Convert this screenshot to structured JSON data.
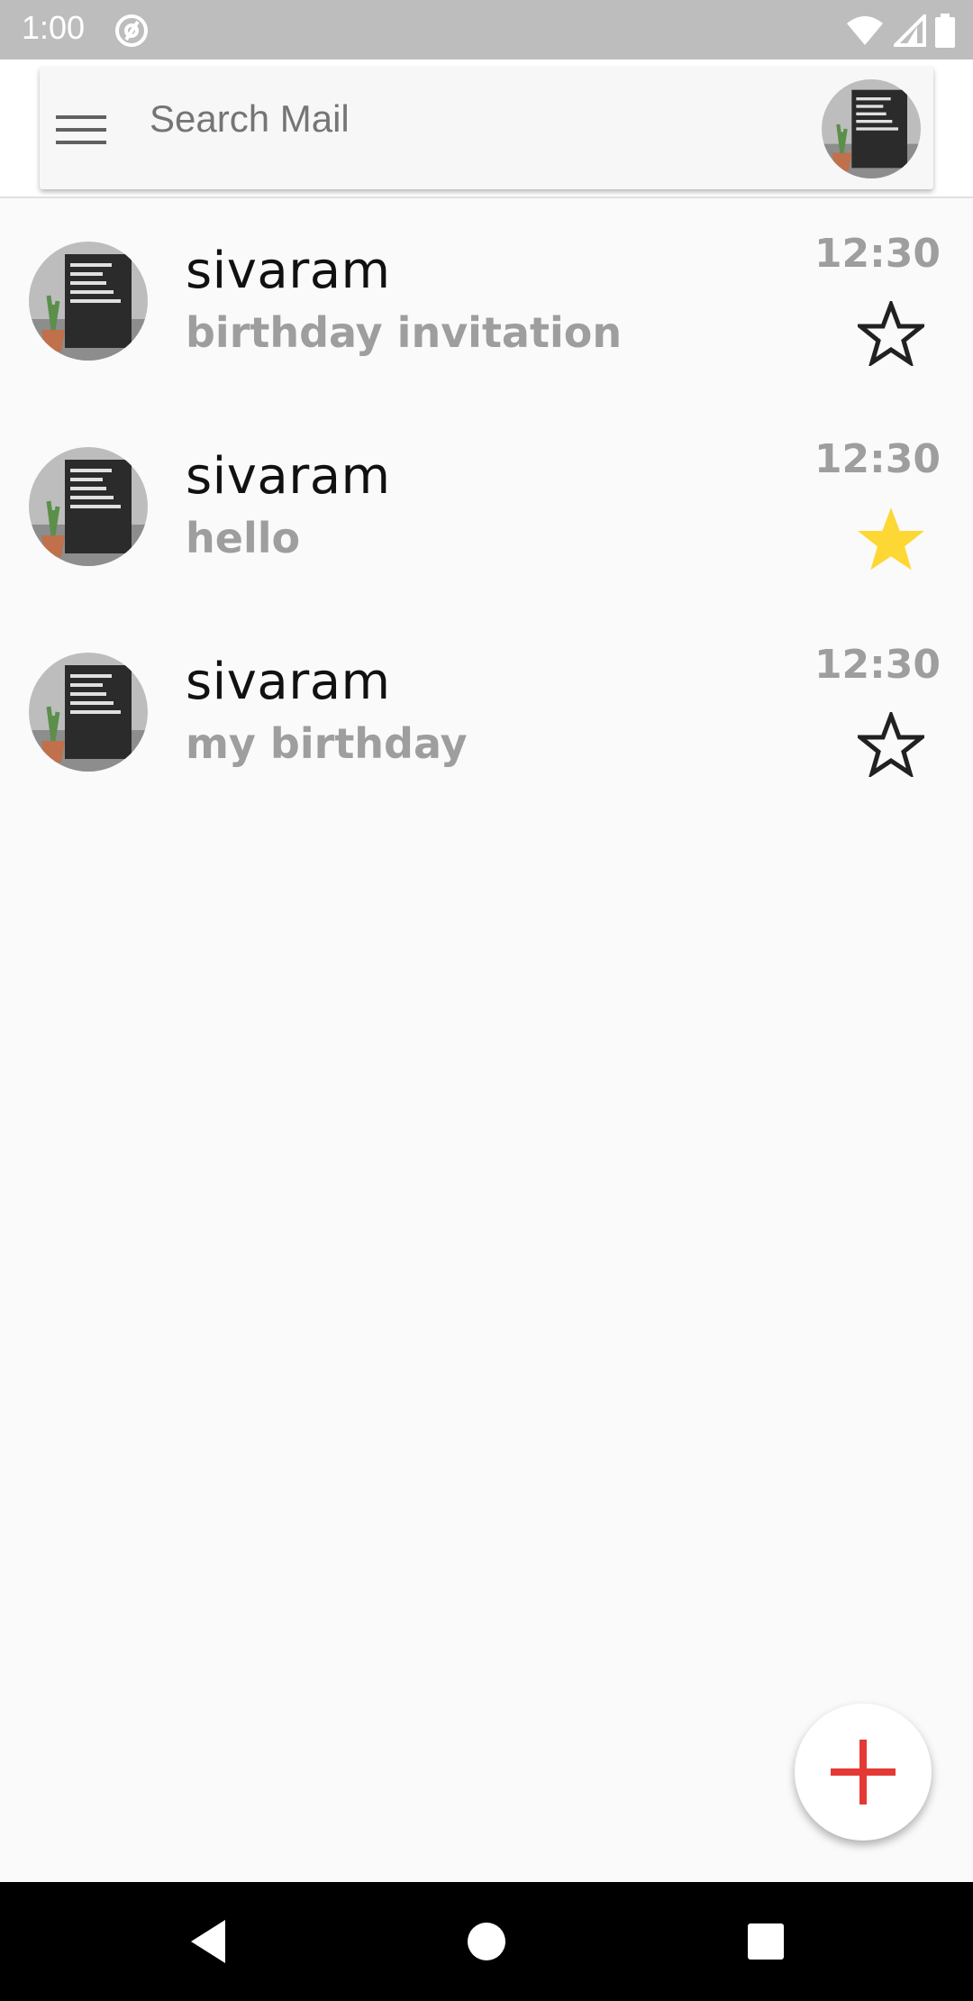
{
  "status_bar": {
    "time": "1:00",
    "icons": [
      "at-sign-icon",
      "wifi-icon",
      "signal-icon",
      "battery-icon"
    ]
  },
  "search": {
    "placeholder": "Search Mail",
    "menu_icon": "hamburger-menu-icon",
    "avatar_icon": "account-avatar"
  },
  "mails": [
    {
      "sender": "sivaram",
      "subject": "birthday invitation",
      "time": "12:30",
      "starred": false
    },
    {
      "sender": "sivaram",
      "subject": "hello",
      "time": "12:30",
      "starred": true
    },
    {
      "sender": "sivaram",
      "subject": "my birthday",
      "time": "12:30",
      "starred": false
    }
  ],
  "fab": {
    "icon": "plus-icon"
  },
  "nav": {
    "icons": [
      "back-icon",
      "home-icon",
      "recents-icon"
    ]
  },
  "colors": {
    "status_bar": "#bdbdbd",
    "star_filled": "#fdd835",
    "fab_plus": "#e53935",
    "subject_text": "#9e9e9e"
  }
}
